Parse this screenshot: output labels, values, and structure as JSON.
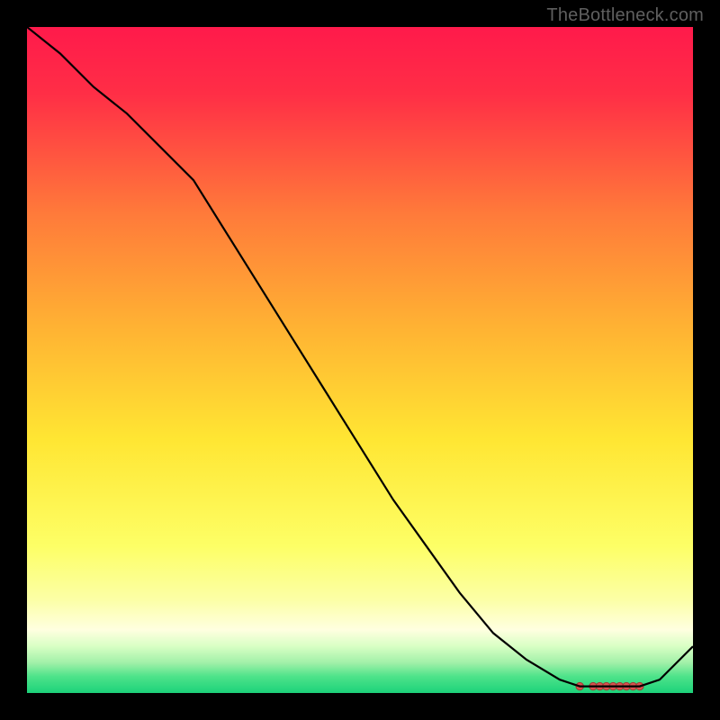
{
  "watermark": "TheBottleneck.com",
  "colors": {
    "curve": "#000000",
    "marker_fill": "#d9534f",
    "marker_stroke": "#a03a36"
  },
  "gradient_stops": [
    {
      "offset": 0.0,
      "color": "#ff1a4b"
    },
    {
      "offset": 0.1,
      "color": "#ff2e46"
    },
    {
      "offset": 0.28,
      "color": "#ff7a3a"
    },
    {
      "offset": 0.45,
      "color": "#ffb233"
    },
    {
      "offset": 0.62,
      "color": "#ffe633"
    },
    {
      "offset": 0.78,
      "color": "#fdff66"
    },
    {
      "offset": 0.86,
      "color": "#fcffa6"
    },
    {
      "offset": 0.905,
      "color": "#ffffe0"
    },
    {
      "offset": 0.93,
      "color": "#d8ffc4"
    },
    {
      "offset": 0.955,
      "color": "#a0f0a8"
    },
    {
      "offset": 0.975,
      "color": "#4ee38a"
    },
    {
      "offset": 1.0,
      "color": "#1cd27a"
    }
  ],
  "chart_data": {
    "type": "line",
    "title": "",
    "xlabel": "",
    "ylabel": "",
    "xlim": [
      0,
      100
    ],
    "ylim": [
      0,
      100
    ],
    "x": [
      0,
      5,
      10,
      15,
      20,
      25,
      30,
      35,
      40,
      45,
      50,
      55,
      60,
      65,
      70,
      75,
      80,
      83,
      86,
      89,
      92,
      95,
      100
    ],
    "values": [
      100,
      96,
      91,
      87,
      82,
      77,
      69,
      61,
      53,
      45,
      37,
      29,
      22,
      15,
      9,
      5,
      2,
      1,
      1,
      1,
      1,
      2,
      7
    ],
    "markers_x": [
      83,
      85,
      86,
      87,
      88,
      89,
      90,
      91,
      92
    ],
    "markers_y": [
      1,
      1,
      1,
      1,
      1,
      1,
      1,
      1,
      1
    ]
  }
}
